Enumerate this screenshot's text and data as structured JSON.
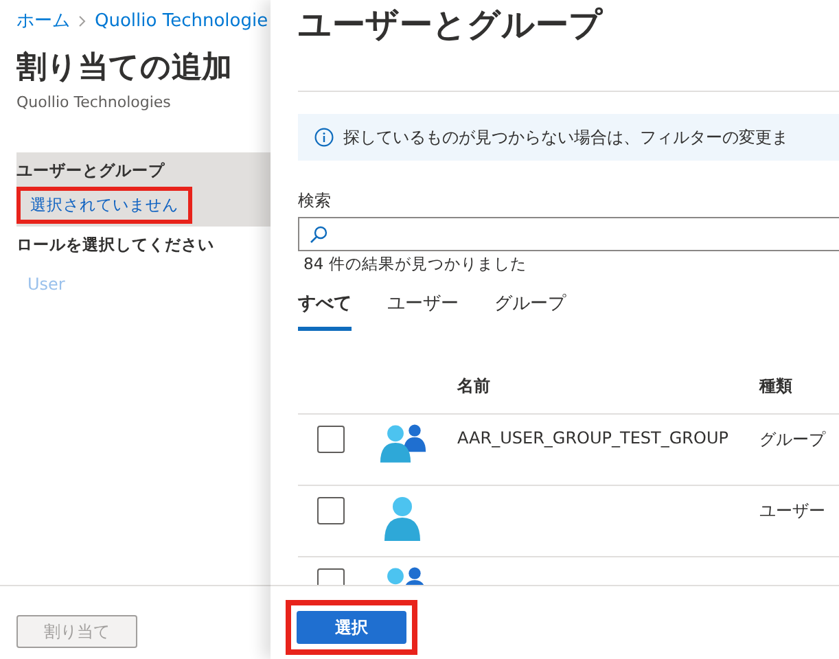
{
  "left_panel": {
    "breadcrumb": [
      {
        "label": "ホーム"
      },
      {
        "label": "Quollio Technologie"
      }
    ],
    "title": "割り当ての追加",
    "subtitle": "Quollio Technologies",
    "sections": [
      {
        "label": "ユーザーとグループ",
        "value": "選択されていません",
        "highlighted": true
      }
    ],
    "role_label": "ロールを選択してください",
    "role_value": "User",
    "assign_button": {
      "label": "割り当て",
      "disabled": true
    }
  },
  "dialog": {
    "title": "ユーザーとグループ",
    "info": "探しているものが見つからない場合は、フィルターの変更ま",
    "search": {
      "label": "検索"
    },
    "result_count": "84 件の結果が見つかりました",
    "tabs": [
      {
        "label": "すべて",
        "selected": true
      },
      {
        "label": "ユーザー",
        "selected": false
      },
      {
        "label": "グループ",
        "selected": false
      }
    ],
    "table": {
      "columns": [
        "名前",
        "種類"
      ],
      "rows": [
        {
          "kind": "group",
          "checked": false,
          "name": "AAR_USER_GROUP_TEST_GROUP",
          "type": "グループ"
        },
        {
          "kind": "user",
          "checked": false,
          "type": "ユーザー"
        },
        {
          "kind": "group",
          "checked": false
        }
      ]
    },
    "select_button": {
      "label": "選択",
      "highlighted": true
    }
  }
}
